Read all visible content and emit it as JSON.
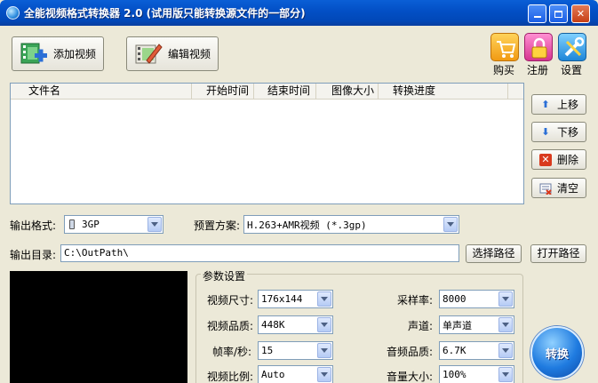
{
  "window": {
    "title": "全能视频格式转换器 2.0 (试用版只能转换源文件的一部分)"
  },
  "toolbar": {
    "add_video": "添加视频",
    "edit_video": "编辑视频"
  },
  "top_icons": {
    "buy": "购买",
    "register": "注册",
    "settings": "设置"
  },
  "file_list": {
    "columns": [
      "文件名",
      "开始时间",
      "结束时间",
      "图像大小",
      "转换进度"
    ]
  },
  "side_buttons": {
    "up": "上移",
    "down": "下移",
    "delete": "删除",
    "clear": "清空"
  },
  "output": {
    "format_label": "输出格式:",
    "format_value": "3GP",
    "preset_label": "预置方案:",
    "preset_value": "H.263+AMR视频 (*.3gp)",
    "dir_label": "输出目录:",
    "dir_value": "C:\\OutPath\\",
    "choose_path": "选择路径",
    "open_path": "打开路径"
  },
  "params": {
    "legend": "参数设置",
    "video_size_label": "视频尺寸:",
    "video_size_value": "176x144",
    "video_quality_label": "视频品质:",
    "video_quality_value": "448K",
    "framerate_label": "帧率/秒:",
    "framerate_value": "15",
    "aspect_label": "视频比例:",
    "aspect_value": "Auto",
    "samplerate_label": "采样率:",
    "samplerate_value": "8000",
    "channel_label": "声道:",
    "channel_value": "单声道",
    "audio_quality_label": "音频品质:",
    "audio_quality_value": "6.7K",
    "volume_label": "音量大小:",
    "volume_value": "100%"
  },
  "convert_button": "转换",
  "colors": {
    "titlebar": "#0350c6",
    "background": "#ece9d8",
    "accent": "#1f7be0"
  }
}
